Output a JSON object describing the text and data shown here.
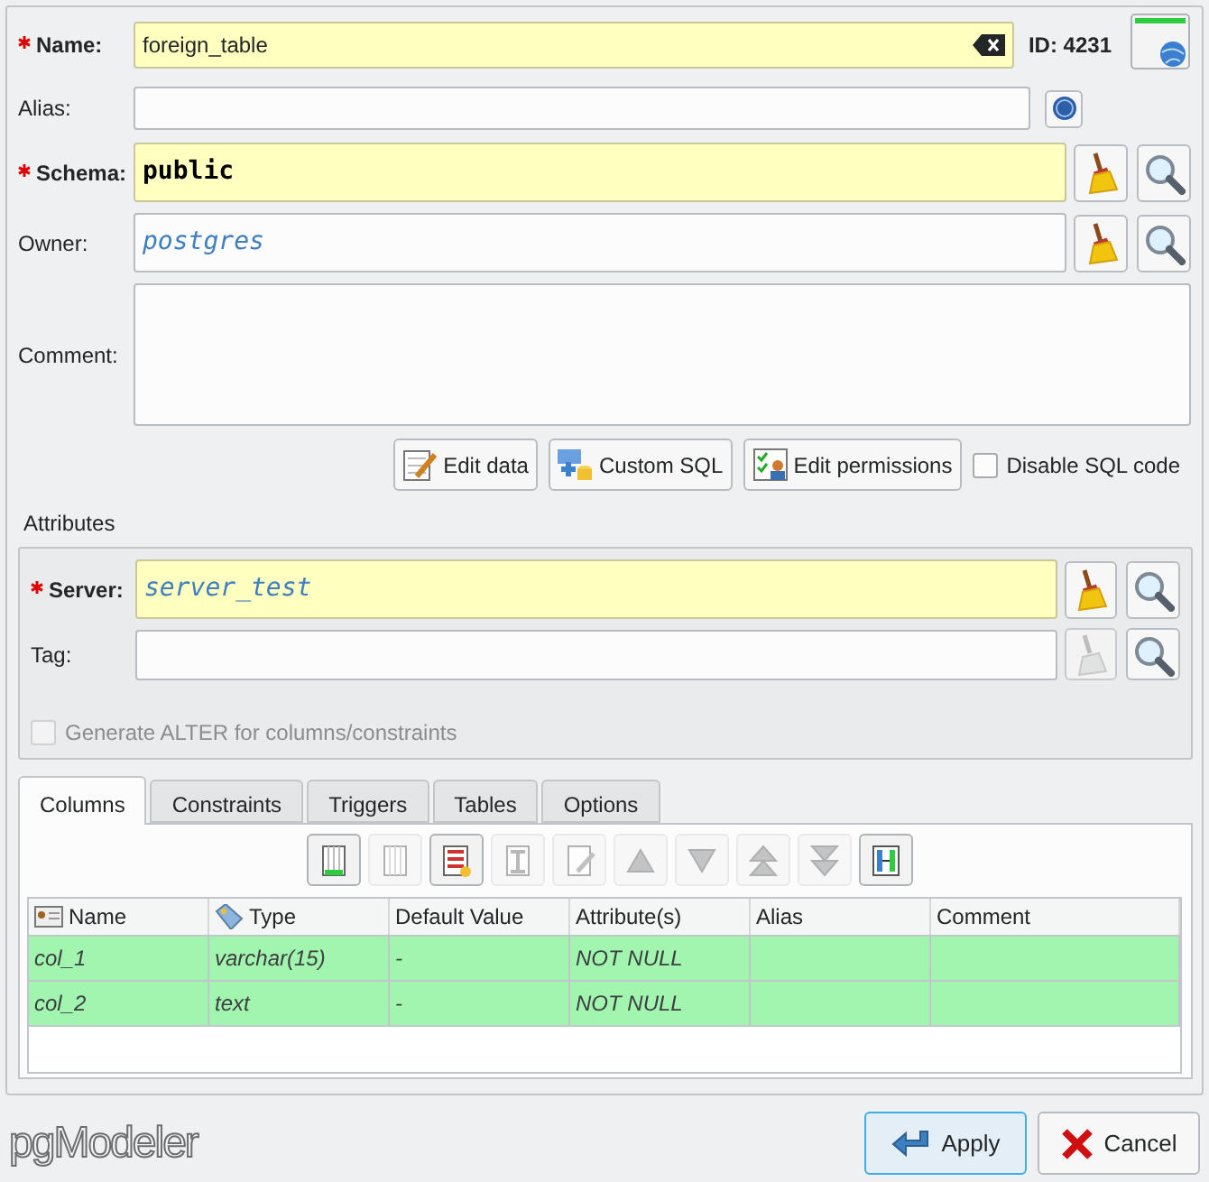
{
  "name_field": {
    "label": "Name:",
    "required": true,
    "value": "foreign_table"
  },
  "id_label": "ID: 4231",
  "alias_field": {
    "label": "Alias:",
    "required": false
  },
  "schema_field": {
    "label": "Schema:",
    "required": true,
    "value": "public"
  },
  "owner_field": {
    "label": "Owner:",
    "required": false,
    "value": "postgres"
  },
  "comment_field": {
    "label": "Comment:"
  },
  "action_buttons": [
    {
      "label": "Edit data",
      "kind": "edit-data"
    },
    {
      "label": "Custom SQL",
      "kind": "sql"
    },
    {
      "label": "Edit permissions",
      "kind": "permissions"
    }
  ],
  "disable_sql": {
    "label": "Disable SQL code",
    "checked": false
  },
  "attributes": {
    "title": "Attributes",
    "server_field": {
      "label": "Server:",
      "required": true,
      "value": "server_test"
    },
    "tag_field": {
      "label": "Tag:",
      "required": false
    },
    "generate_alter": {
      "label": "Generate ALTER for columns/constraints",
      "checked": false,
      "disabled": true
    }
  },
  "tabs": [
    {
      "label": "Columns",
      "selected": true
    },
    {
      "label": "Constraints",
      "selected": false
    },
    {
      "label": "Triggers",
      "selected": false
    },
    {
      "label": "Tables",
      "selected": false
    },
    {
      "label": "Options",
      "selected": false
    }
  ],
  "toolbar": [
    {
      "kind": "add",
      "disabled": false
    },
    {
      "kind": "remove",
      "disabled": true
    },
    {
      "kind": "remove-all",
      "disabled": false
    },
    {
      "kind": "update",
      "disabled": true
    },
    {
      "kind": "edit",
      "disabled": true
    },
    {
      "kind": "up",
      "disabled": true
    },
    {
      "kind": "down",
      "disabled": true
    },
    {
      "kind": "top",
      "disabled": true
    },
    {
      "kind": "bottom",
      "disabled": true
    },
    {
      "kind": "resize",
      "disabled": false
    }
  ],
  "table": {
    "columns": [
      {
        "label": "Name",
        "kind": "name"
      },
      {
        "label": "Type",
        "kind": "type"
      },
      {
        "label": "Default Value"
      },
      {
        "label": "Attribute(s)"
      },
      {
        "label": "Alias"
      },
      {
        "label": "Comment"
      }
    ],
    "rows": [
      [
        "col_1",
        "varchar(15)",
        "-",
        "NOT NULL",
        "",
        ""
      ],
      [
        "col_2",
        "text",
        "-",
        "NOT NULL",
        "",
        ""
      ]
    ]
  },
  "logo": "pgModeler",
  "buttons": [
    {
      "label": "Apply",
      "kind": "apply"
    },
    {
      "label": "Cancel",
      "kind": "cancel"
    }
  ]
}
